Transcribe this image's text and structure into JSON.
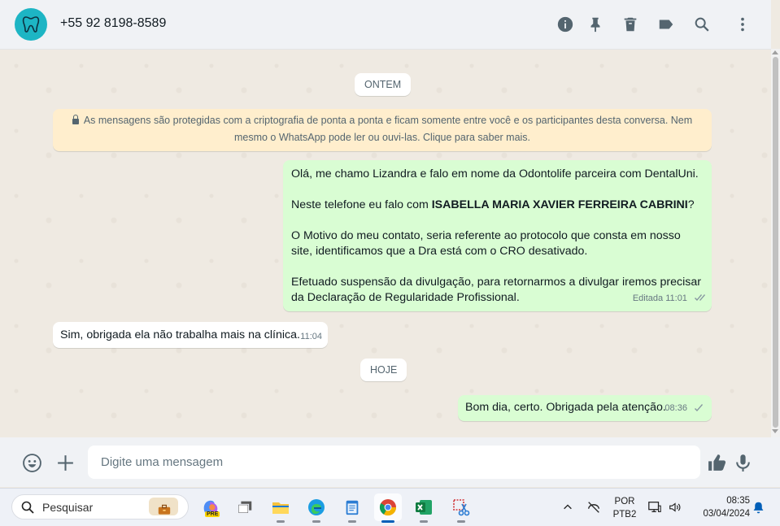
{
  "header": {
    "contact_name": "+55 92 8198-8589",
    "avatar_label": "OdontoPlus",
    "icons": [
      "info-icon",
      "pin-icon",
      "delete-icon",
      "label-icon",
      "search-icon",
      "menu-icon"
    ]
  },
  "chat": {
    "date_yesterday": "ONTEM",
    "date_today": "HOJE",
    "encryption_line1": "As mensagens são protegidas com a criptografia de ponta a ponta e ficam somente entre você e os participantes desta conversa. Nem",
    "encryption_line2": "mesmo o WhatsApp pode ler ou ouvi-las. Clique para saber mais.",
    "msg1": {
      "p1": "Olá, me chamo Lizandra e falo em nome da Odontolife parceira com DentalUni.",
      "p2_prefix": "Neste telefone eu falo com ",
      "p2_bold": "ISABELLA MARIA XAVIER FERREIRA CABRINI",
      "p2_suffix": "?",
      "p3": "O Motivo do meu contato, seria referente ao protocolo que consta em nosso site, identificamos que a Dra está com o CRO desativado.",
      "p4": "Efetuado suspensão da divulgação, para retornarmos a divulgar iremos precisar da Declaração de Regularidade Profissional.",
      "edited": "Editada",
      "time": "11:01",
      "status": "read"
    },
    "msg2": {
      "text": "Sim, obrigada ela não trabalha mais na clínica.",
      "time": "11:04"
    },
    "msg3": {
      "text": "Bom dia, certo. Obrigada pela atenção.",
      "time": "08:36",
      "status": "sent"
    }
  },
  "compose": {
    "placeholder": "Digite uma mensagem",
    "value": ""
  },
  "taskbar": {
    "search_placeholder": "Pesquisar",
    "copilot_badge": "PRE",
    "lang_line1": "POR",
    "lang_line2": "PTB2",
    "time": "08:35",
    "date": "03/04/2024"
  },
  "colors": {
    "outgoing_bubble": "#d9fdd3",
    "incoming_bubble": "#ffffff",
    "encryption_notice": "#ffeecd",
    "chat_background": "#efeae2",
    "avatar": "#1db5c4"
  }
}
